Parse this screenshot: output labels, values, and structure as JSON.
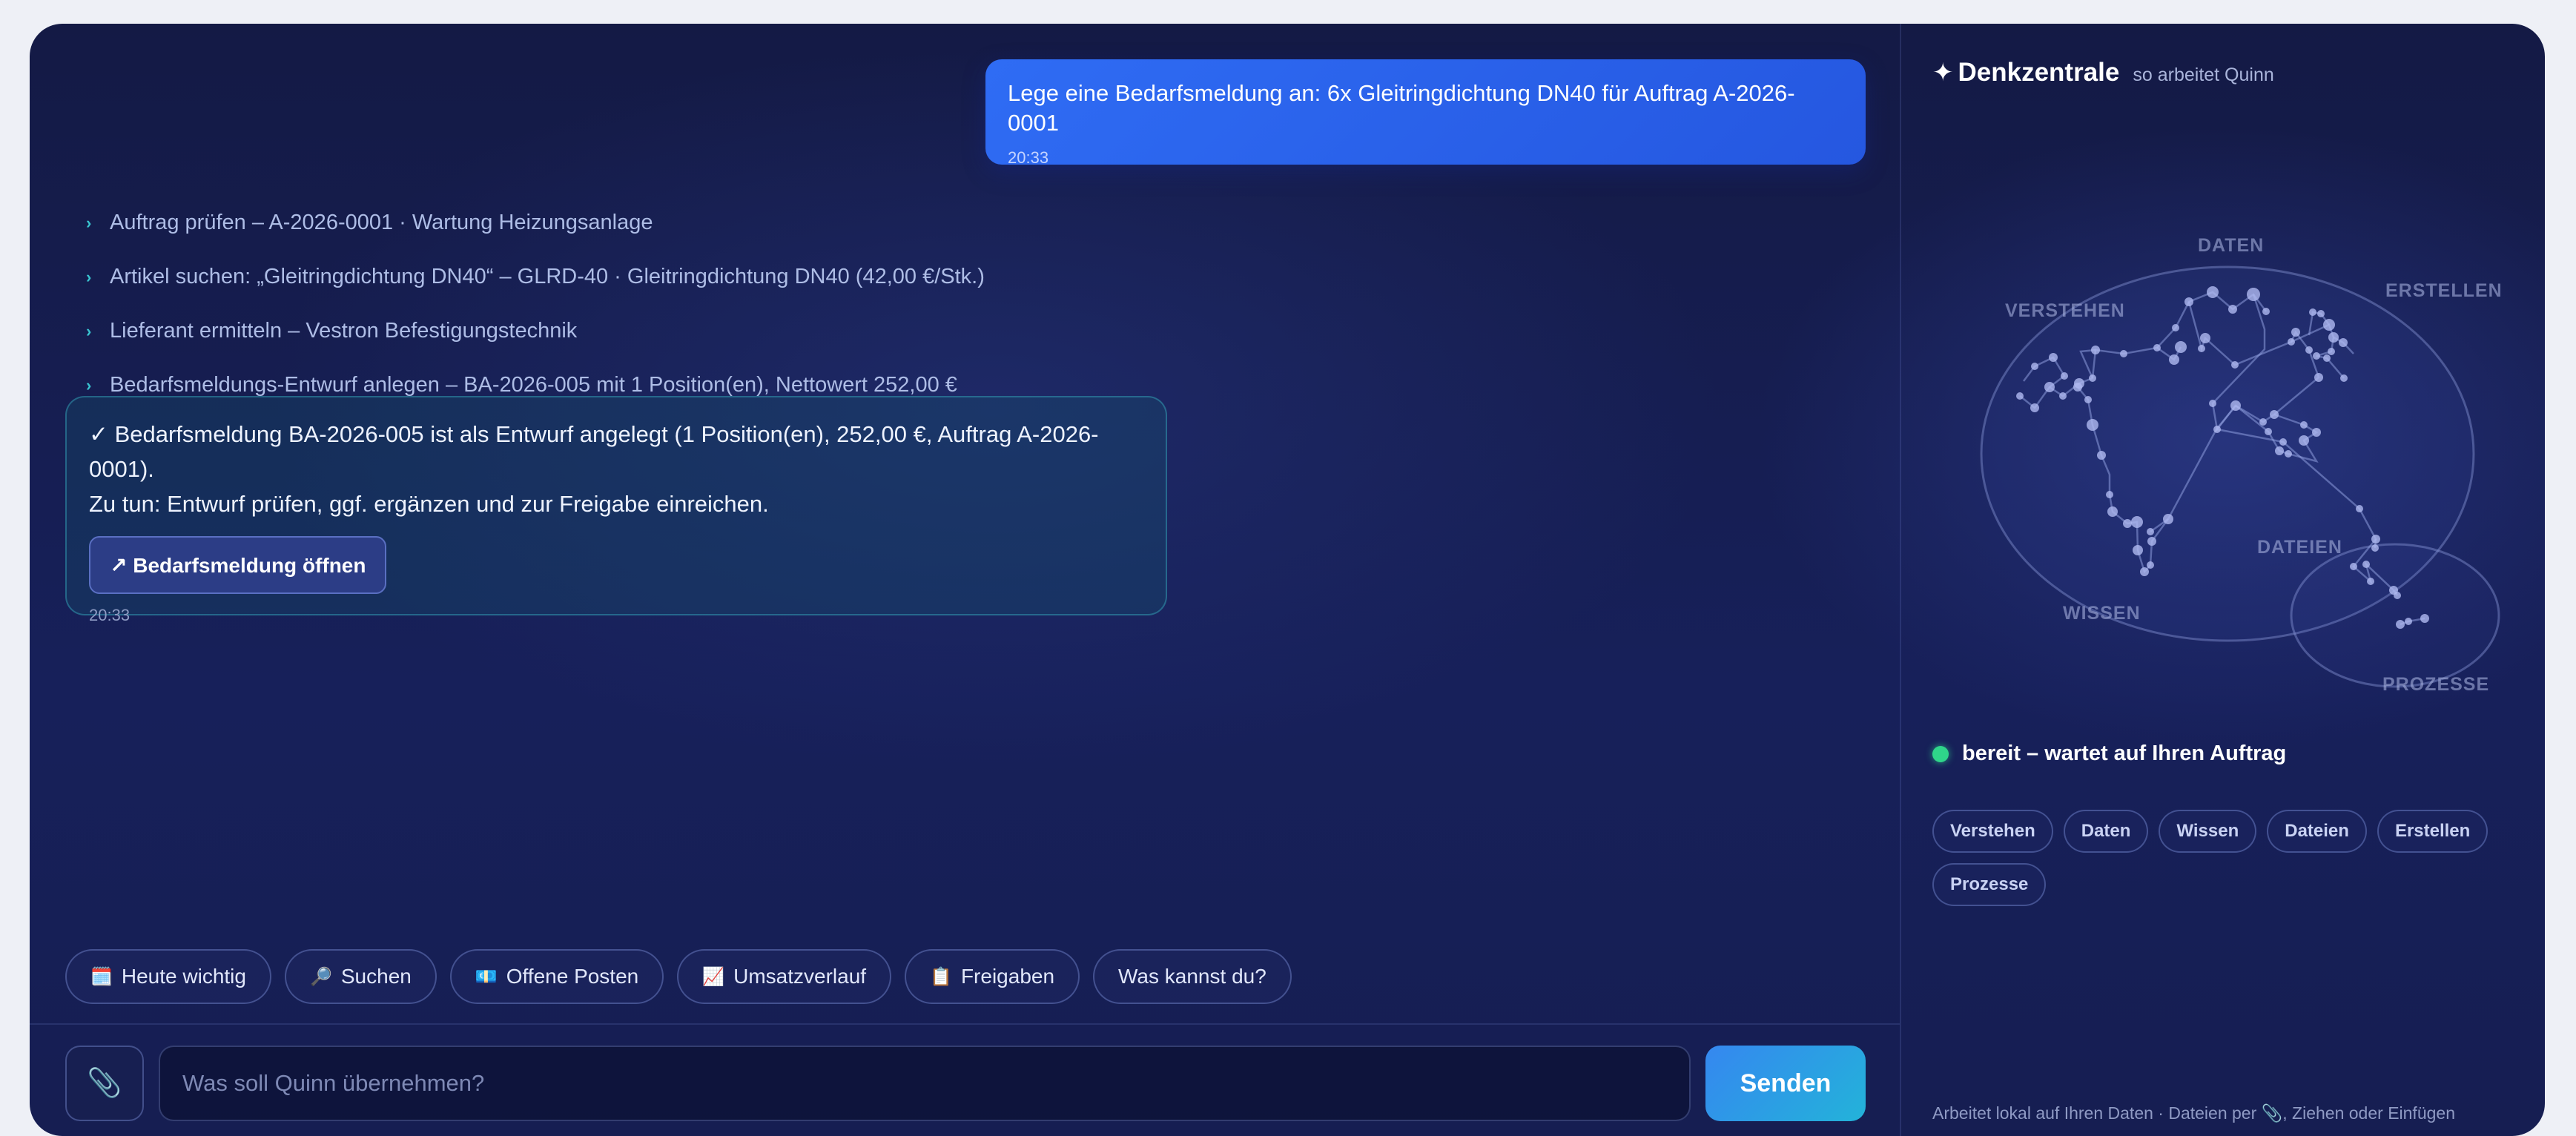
{
  "chat": {
    "user_message": {
      "text": "Lege eine Bedarfsmeldung an: 6x Gleitringdichtung DN40 für Auftrag A-2026-0001",
      "time": "20:33"
    },
    "steps": [
      "Auftrag prüfen – A-2026-0001 · Wartung Heizungsanlage",
      "Artikel suchen: „Gleitringdichtung DN40“ – GLRD-40 · Gleitringdichtung DN40 (42,00 €/Stk.)",
      "Lieferant ermitteln – Vestron Befestigungstechnik",
      "Bedarfsmeldungs-Entwurf anlegen – BA-2026-005 mit 1 Position(en), Nettowert 252,00 €"
    ],
    "result": {
      "line1": "✓ Bedarfsmeldung BA-2026-005 ist als Entwurf angelegt (1 Position(en), 252,00 €, Auftrag A-2026-0001).",
      "line2": "Zu tun: Entwurf prüfen, ggf. ergänzen und zur Freigabe einreichen.",
      "button": "↗ Bedarfsmeldung öffnen",
      "time": "20:33"
    },
    "quick_actions": [
      {
        "icon": "🗓️",
        "label": "Heute wichtig"
      },
      {
        "icon": "🔎",
        "label": "Suchen"
      },
      {
        "icon": "💶",
        "label": "Offene Posten"
      },
      {
        "icon": "📈",
        "label": "Umsatzverlauf"
      },
      {
        "icon": "📋",
        "label": "Freigaben"
      },
      {
        "icon": "",
        "label": "Was kannst du?"
      }
    ],
    "input": {
      "placeholder": "Was soll Quinn übernehmen?",
      "attach_icon": "📎"
    },
    "send_label": "Senden"
  },
  "side": {
    "star": "✦",
    "title": "Denkzentrale",
    "subtitle": "so arbeitet Quinn",
    "map_labels": {
      "daten": "DATEN",
      "erstellen": "ERSTELLEN",
      "verstehen": "VERSTEHEN",
      "dateien": "DATEIEN",
      "wissen": "WISSEN",
      "prozesse": "PROZESSE"
    },
    "status_text": "bereit – wartet auf Ihren Auftrag",
    "tags": [
      "Verstehen",
      "Daten",
      "Wissen",
      "Dateien",
      "Erstellen",
      "Prozesse"
    ],
    "footer": "Arbeitet lokal auf Ihren Daten · Dateien per 📎, Ziehen oder Einfügen"
  },
  "colors": {
    "accent": "#2f6cf4",
    "status": "#2fd58a",
    "teal": "#39c3cf"
  }
}
